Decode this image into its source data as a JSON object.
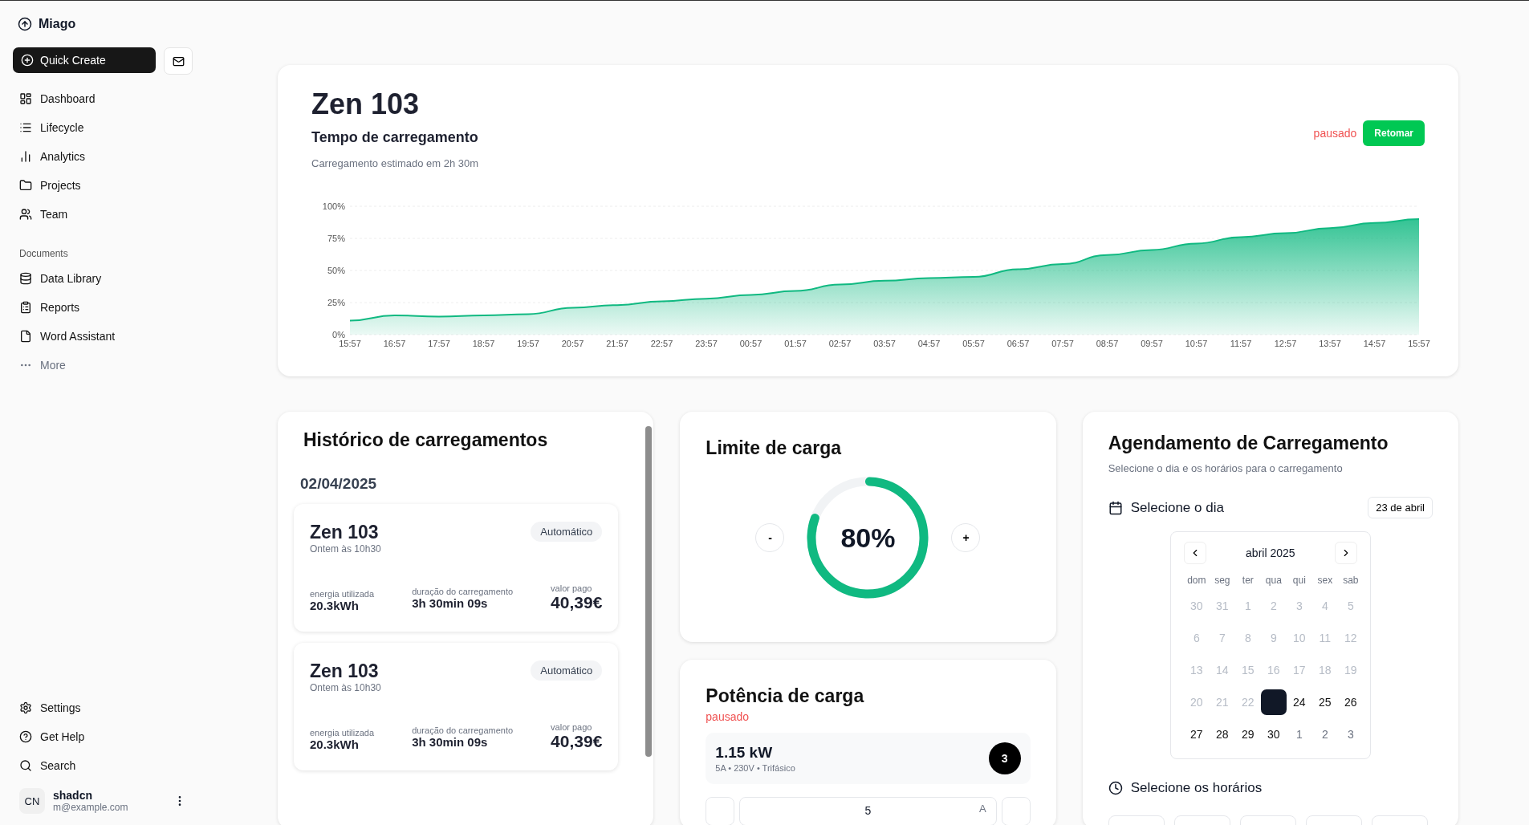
{
  "sidebar": {
    "brand": "Miago",
    "quick_create": "Quick Create",
    "items": [
      {
        "label": "Dashboard"
      },
      {
        "label": "Lifecycle"
      },
      {
        "label": "Analytics"
      },
      {
        "label": "Projects"
      },
      {
        "label": "Team"
      }
    ],
    "documents": {
      "heading": "Documents",
      "items": [
        {
          "label": "Data Library"
        },
        {
          "label": "Reports"
        },
        {
          "label": "Word Assistant"
        }
      ],
      "more": "More"
    },
    "footer_items": [
      {
        "label": "Settings"
      },
      {
        "label": "Get Help"
      },
      {
        "label": "Search"
      }
    ],
    "user": {
      "initials": "CN",
      "name": "shadcn",
      "email": "m@example.com"
    }
  },
  "charging": {
    "title": "Zen 103",
    "subtitle": "Tempo de carregamento",
    "description": "Carregamento estimado em 2h 30m",
    "status": "pausado",
    "action": "Retomar",
    "chart_data": {
      "type": "area",
      "categories": [
        "15:57",
        "16:57",
        "17:57",
        "18:57",
        "19:57",
        "20:57",
        "21:57",
        "22:57",
        "23:57",
        "00:57",
        "01:57",
        "02:57",
        "03:57",
        "04:57",
        "05:57",
        "06:57",
        "07:57",
        "08:57",
        "09:57",
        "10:57",
        "11:57",
        "12:57",
        "13:57",
        "14:57",
        "15:57"
      ],
      "grid": true,
      "series": [
        {
          "color": "#10b981",
          "values": [
            11,
            15,
            14,
            15,
            16,
            21,
            23,
            26,
            28,
            31,
            34,
            39,
            42,
            44,
            45,
            51,
            55,
            62,
            66,
            71,
            76,
            79,
            83,
            87,
            90
          ]
        }
      ],
      "ylim": [
        0,
        100
      ],
      "yticks": [
        {
          "value": 0,
          "label": "0%"
        },
        {
          "value": 25,
          "label": "25%"
        },
        {
          "value": 50,
          "label": "50%"
        },
        {
          "value": 75,
          "label": "75%"
        },
        {
          "value": 100,
          "label": "100%"
        }
      ]
    }
  },
  "history": {
    "title": "Histórico de carregamentos",
    "date": "02/04/2025",
    "records": [
      {
        "name": "Zen 103",
        "time": "Ontem às 10h30",
        "mode": "Automático",
        "energy_label": "energia utilizada",
        "energy": "20.3kWh",
        "duration_label": "duração do carregamento",
        "duration": "3h 30min 09s",
        "paid_label": "valor pago",
        "paid": "40,39€"
      },
      {
        "name": "Zen 103",
        "time": "Ontem às 10h30",
        "mode": "Automático",
        "energy_label": "energia utilizada",
        "energy": "20.3kWh",
        "duration_label": "duração do carregamento",
        "duration": "3h 30min 09s",
        "paid_label": "valor pago",
        "paid": "40,39€"
      }
    ]
  },
  "limit": {
    "title": "Limite de carga",
    "minus": "-",
    "plus": "+",
    "reading": "80%",
    "level": 0.8
  },
  "power": {
    "title": "Potência de carga",
    "status": "pausado",
    "value": "1.15 kW",
    "details": "5A • 230V • Trifásico",
    "phases": "3",
    "current": "5",
    "unit": "A"
  },
  "schedule": {
    "title": "Agendamento de Carregamento",
    "description": "Selecione o dia e os horários para o carregamento",
    "day_heading": "Selecione o dia",
    "chosen_date": "23 de abril",
    "month": "abril 2025",
    "weekdays": [
      "dom",
      "seg",
      "ter",
      "qua",
      "qui",
      "sex",
      "sab"
    ],
    "weeks": [
      [
        {
          "label": "30",
          "kind": "past",
          "selected": false
        },
        {
          "label": "31",
          "kind": "past",
          "selected": false
        },
        {
          "label": "1",
          "kind": "past",
          "selected": false
        },
        {
          "label": "2",
          "kind": "past",
          "selected": false
        },
        {
          "label": "3",
          "kind": "past",
          "selected": false
        },
        {
          "label": "4",
          "kind": "past",
          "selected": false
        },
        {
          "label": "5",
          "kind": "past",
          "selected": false
        }
      ],
      [
        {
          "label": "6",
          "kind": "past",
          "selected": false
        },
        {
          "label": "7",
          "kind": "past",
          "selected": false
        },
        {
          "label": "8",
          "kind": "past",
          "selected": false
        },
        {
          "label": "9",
          "kind": "past",
          "selected": false
        },
        {
          "label": "10",
          "kind": "past",
          "selected": false
        },
        {
          "label": "11",
          "kind": "past",
          "selected": false
        },
        {
          "label": "12",
          "kind": "past",
          "selected": false
        }
      ],
      [
        {
          "label": "13",
          "kind": "past",
          "selected": false
        },
        {
          "label": "14",
          "kind": "past",
          "selected": false
        },
        {
          "label": "15",
          "kind": "past",
          "selected": false
        },
        {
          "label": "16",
          "kind": "past",
          "selected": false
        },
        {
          "label": "17",
          "kind": "past",
          "selected": false
        },
        {
          "label": "18",
          "kind": "past",
          "selected": false
        },
        {
          "label": "19",
          "kind": "past",
          "selected": false
        }
      ],
      [
        {
          "label": "20",
          "kind": "past",
          "selected": false
        },
        {
          "label": "21",
          "kind": "past",
          "selected": false
        },
        {
          "label": "22",
          "kind": "past",
          "selected": false
        },
        {
          "kind": "day",
          "selected": true
        },
        {
          "label": "24",
          "kind": "day",
          "selected": false
        },
        {
          "label": "25",
          "kind": "day",
          "selected": false
        },
        {
          "label": "26",
          "kind": "day",
          "selected": false
        }
      ],
      [
        {
          "label": "27",
          "kind": "day",
          "selected": false
        },
        {
          "label": "28",
          "kind": "day",
          "selected": false
        },
        {
          "label": "29",
          "kind": "day",
          "selected": false
        },
        {
          "label": "30",
          "kind": "day",
          "selected": false
        },
        {
          "label": "1",
          "kind": "outside",
          "selected": false
        },
        {
          "label": "2",
          "kind": "outside",
          "selected": false
        },
        {
          "label": "3",
          "kind": "outside",
          "selected": false
        }
      ]
    ],
    "time_heading": "Selecione os horários"
  }
}
